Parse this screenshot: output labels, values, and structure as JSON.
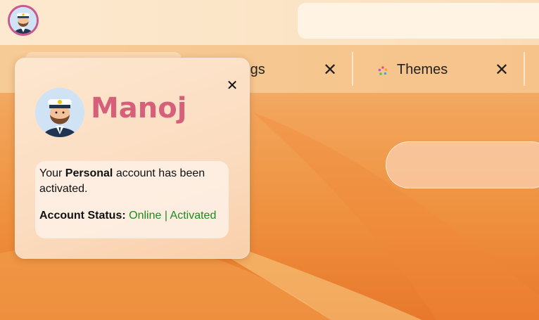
{
  "user": {
    "name": "Manoj",
    "account_type": "Personal",
    "message_prefix": "Your ",
    "message_suffix": " account has been activated.",
    "status_label": "Account Status:",
    "status_value": "Online | Activated"
  },
  "tabs": [
    {
      "label": "Settings",
      "visible_label": "ings",
      "icon": "settings-icon"
    },
    {
      "label": "Themes",
      "icon": "themes-icon"
    }
  ],
  "icons": {
    "close": "close-icon",
    "avatar": "captain-avatar-icon"
  },
  "colors": {
    "user_name": "#d6607a",
    "status_ok": "#1e8a1e",
    "avatar_ring": "#c9588f"
  }
}
